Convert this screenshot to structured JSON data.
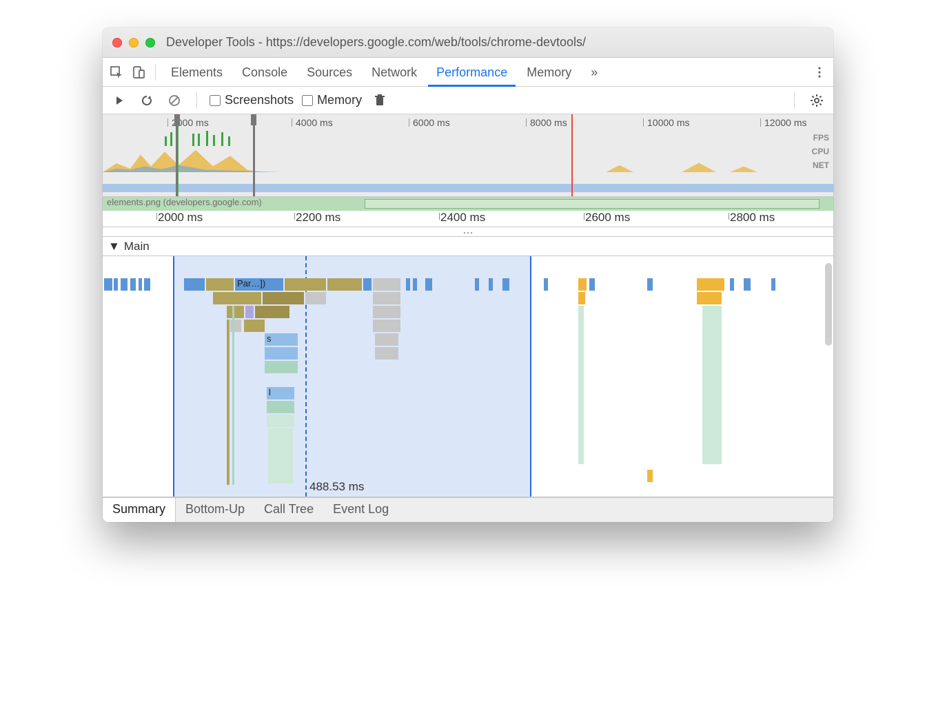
{
  "window": {
    "title": "Developer Tools - https://developers.google.com/web/tools/chrome-devtools/"
  },
  "mainTabs": {
    "items": [
      "Elements",
      "Console",
      "Sources",
      "Network",
      "Performance",
      "Memory"
    ],
    "activeIndex": 4,
    "overflowGlyph": "»"
  },
  "perfToolbar": {
    "screenshots_label": "Screenshots",
    "memory_label": "Memory"
  },
  "overview": {
    "ticks": [
      "2000 ms",
      "4000 ms",
      "6000 ms",
      "8000 ms",
      "10000 ms",
      "12000 ms"
    ],
    "lanes": [
      "FPS",
      "CPU",
      "NET"
    ]
  },
  "networkRow": {
    "label": "elements.png (developers.google.com)"
  },
  "msRuler": {
    "ticks": [
      "2000 ms",
      "2200 ms",
      "2400 ms",
      "2600 ms",
      "2800 ms"
    ]
  },
  "mainTrack": {
    "label": "Main",
    "parseLabel": "Par…])",
    "s_label": "s",
    "l_label": "l",
    "selection_ms": "488.53 ms"
  },
  "bottomTabs": {
    "items": [
      "Summary",
      "Bottom-Up",
      "Call Tree",
      "Event Log"
    ],
    "activeIndex": 0
  },
  "colors": {
    "accent": "#1a73e8",
    "scripting": "#f0b63a",
    "rendering": "#b2a5db",
    "painting": "#a9d5be",
    "loading": "#5b95d6"
  }
}
